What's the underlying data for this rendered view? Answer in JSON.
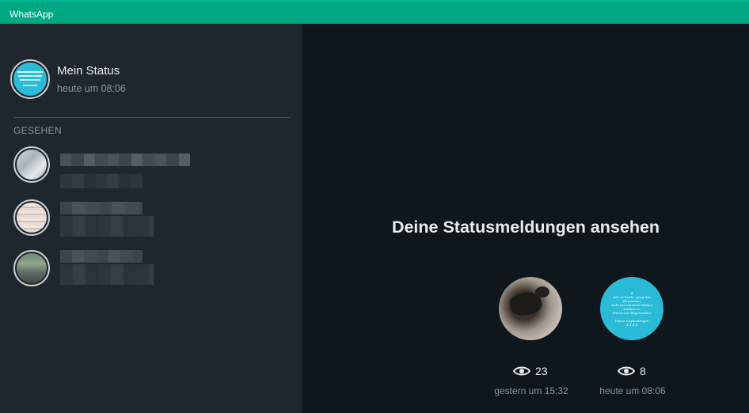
{
  "app": {
    "title": "WhatsApp"
  },
  "my_status": {
    "name": "Mein Status",
    "time": "heute um 08:06"
  },
  "section": {
    "seen_label": "GESEHEN"
  },
  "viewer": {
    "heading": "Deine Statusmeldungen ansehen",
    "items": [
      {
        "views": "23",
        "time": "gestern um 15:32",
        "thumb": "dog-photo"
      },
      {
        "views": "8",
        "time": "heute um 08:06",
        "thumb": "text-status"
      }
    ]
  },
  "colors": {
    "titlebar": "#00a884",
    "sidebar": "#1f262d",
    "main": "#0f161c",
    "status_bg": "#2bbbd6"
  }
}
